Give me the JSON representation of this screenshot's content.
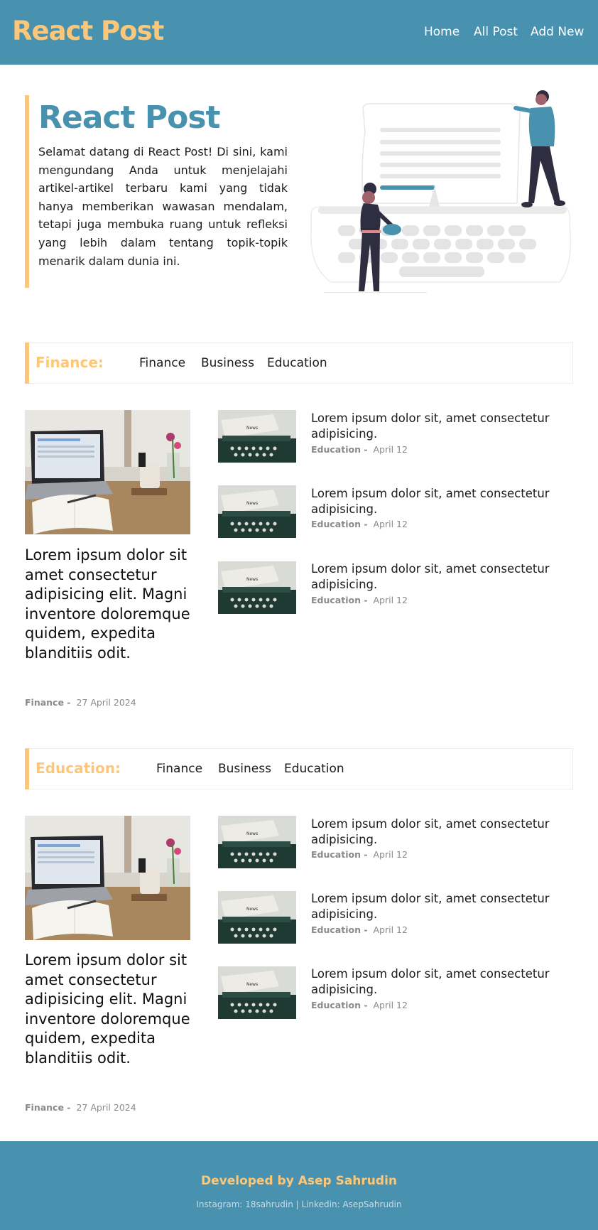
{
  "navbar": {
    "brand": "React Post",
    "links": [
      "Home",
      "All Post",
      "Add New"
    ]
  },
  "hero": {
    "title": "React Post",
    "description": "Selamat datang di React Post! Di sini, kami mengundang Anda untuk menjelajahi artikel-artikel terbaru kami yang tidak hanya memberikan wawasan mendalam, tetapi juga membuka ruang untuk refleksi yang lebih dalam tentang topik-topik menarik dalam dunia ini."
  },
  "sections": [
    {
      "label": "Finance:",
      "categories": [
        "Finance",
        "Business",
        "Education"
      ],
      "featured": {
        "title": "Lorem ipsum dolor sit amet consectetur adipisicing elit. Magni inventore doloremque quidem, expedita blanditiis odit.",
        "category": "Finance -",
        "date": "27 April 2024"
      },
      "posts": [
        {
          "title": "Lorem ipsum dolor sit, amet consectetur adipisicing.",
          "category": "Education -",
          "date": "April 12"
        },
        {
          "title": "Lorem ipsum dolor sit, amet consectetur adipisicing.",
          "category": "Education -",
          "date": "April 12"
        },
        {
          "title": "Lorem ipsum dolor sit, amet consectetur adipisicing.",
          "category": "Education -",
          "date": "April 12"
        }
      ]
    },
    {
      "label": "Education:",
      "categories": [
        "Finance",
        "Business",
        "Education"
      ],
      "featured": {
        "title": "Lorem ipsum dolor sit amet consectetur adipisicing elit. Magni inventore doloremque quidem, expedita blanditiis odit.",
        "category": "Finance -",
        "date": "27 April 2024"
      },
      "posts": [
        {
          "title": "Lorem ipsum dolor sit, amet consectetur adipisicing.",
          "category": "Education -",
          "date": "April 12"
        },
        {
          "title": "Lorem ipsum dolor sit, amet consectetur adipisicing.",
          "category": "Education -",
          "date": "April 12"
        },
        {
          "title": "Lorem ipsum dolor sit, amet consectetur adipisicing.",
          "category": "Education -",
          "date": "April 12"
        }
      ]
    }
  ],
  "footer": {
    "title": "Developed by Asep Sahrudin",
    "social": "Instagram: 18sahrudin | Linkedin: AsepSahrudin"
  },
  "colors": {
    "primary": "#4891af",
    "accent": "#fcc779",
    "text": "#1c1c1c",
    "muted": "#8a8a8a"
  }
}
